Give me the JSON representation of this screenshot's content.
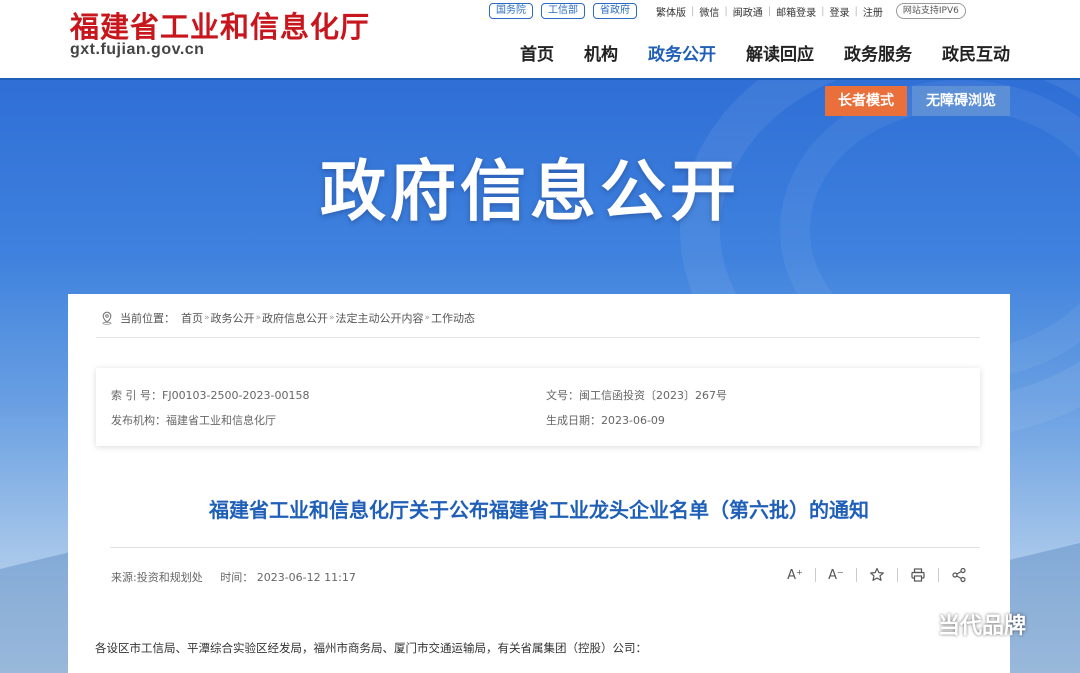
{
  "header": {
    "logo_cn": "福建省工业和信息化厅",
    "logo_en": "gxt.fujian.gov.cn",
    "tag_links": [
      "国务院",
      "工信部",
      "省政府"
    ],
    "util_links": [
      "繁体版",
      "微信",
      "闽政通",
      "邮箱登录",
      "登录",
      "注册"
    ],
    "ipv6": "网站支持IPV6",
    "nav": [
      "首页",
      "机构",
      "政务公开",
      "解读回应",
      "政务服务",
      "政民互动"
    ],
    "active_nav": "政务公开"
  },
  "banner": {
    "title": "政府信息公开",
    "elder_mode": "长者模式",
    "accessible_mode": "无障碍浏览"
  },
  "breadcrumb": {
    "label": "当前位置：",
    "items": [
      "首页",
      "政务公开",
      "政府信息公开",
      "法定主动公开内容",
      "工作动态"
    ]
  },
  "meta": {
    "index_no": "索 引 号：FJ00103-2500-2023-00158",
    "doc_no": "文号：闽工信函投资〔2023〕267号",
    "issuer": "发布机构：福建省工业和信息化厅",
    "date": "生成日期：2023-06-09"
  },
  "article": {
    "title": "福建省工业和信息化厅关于公布福建省工业龙头企业名单（第六批）的通知",
    "source": "来源:投资和规划处",
    "time": "时间： 2023-06-12 11:17",
    "greeting": "各设区市工信局、平潭综合实验区经发局，福州市商务局、厦门市交通运输局，有关省属集团（控股）公司："
  },
  "tools": {
    "font_larger": "A⁺",
    "font_smaller": "A⁻"
  },
  "watermark": {
    "text": "当代品牌"
  },
  "colors": {
    "brand_red": "#c8161d",
    "brand_blue": "#1f5fb8",
    "elder_orange": "#e9703a"
  }
}
